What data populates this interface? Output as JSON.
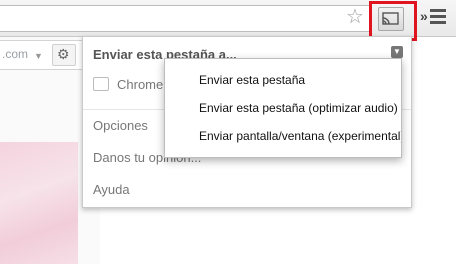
{
  "toolbar": {
    "icons": [
      "star-icon",
      "cast-icon",
      "chevrons-icon",
      "menu-icon"
    ],
    "chevrons": "»"
  },
  "page": {
    "url_fragment": ".com",
    "gear_icon": "gear-icon"
  },
  "popup": {
    "header": "Enviar esta pestaña a...",
    "chrome_label": "Chrome",
    "items": [
      "Opciones",
      "Danos tu opinión...",
      "Ayuda"
    ]
  },
  "submenu": {
    "items": [
      "Enviar esta pestaña",
      "Enviar esta pestaña (optimizar audio)",
      "Enviar pantalla/ventana (experimental)"
    ]
  },
  "colors": {
    "highlight": "#e0141f"
  }
}
